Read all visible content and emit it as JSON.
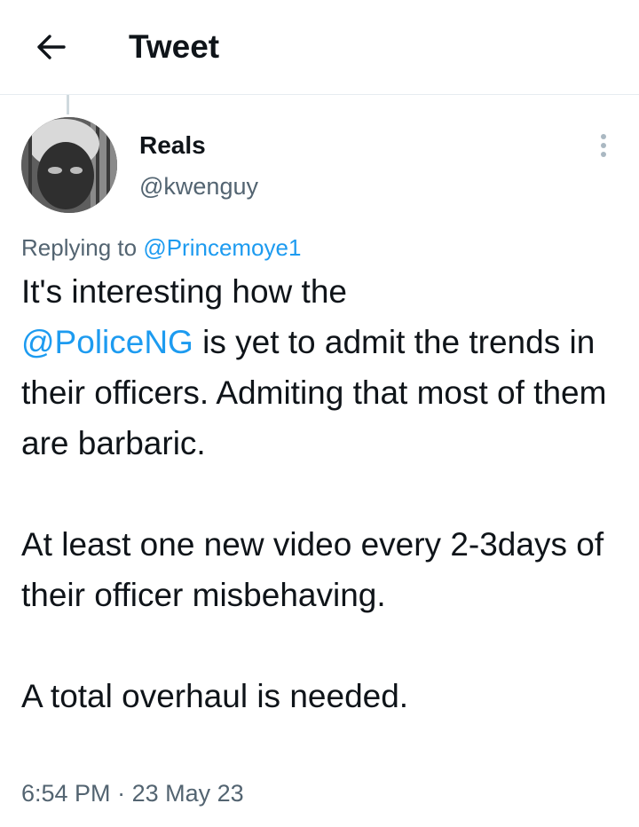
{
  "header": {
    "title": "Tweet",
    "back_icon": "arrow-left-icon"
  },
  "author": {
    "display_name": "Reals",
    "handle": "@kwenguy",
    "more_icon": "more-vertical-icon"
  },
  "reply": {
    "prefix": "Replying to",
    "to": "@Princemoye1"
  },
  "tweet": {
    "line1_pre": "It's interesting how the",
    "mention": "@PoliceNG",
    "line1_post": " is yet to admit the trends in their officers. Admiting that most of them are barbaric.",
    "para2": "At least one new video every 2-3days of their officer misbehaving.",
    "para3": "A total overhaul is needed."
  },
  "meta": {
    "time": "6:54 PM",
    "separator": " · ",
    "date": "23 May 23"
  },
  "colors": {
    "link": "#1d9bf0",
    "muted": "#536471",
    "text": "#0f1419",
    "divider": "#e6ecf0"
  }
}
